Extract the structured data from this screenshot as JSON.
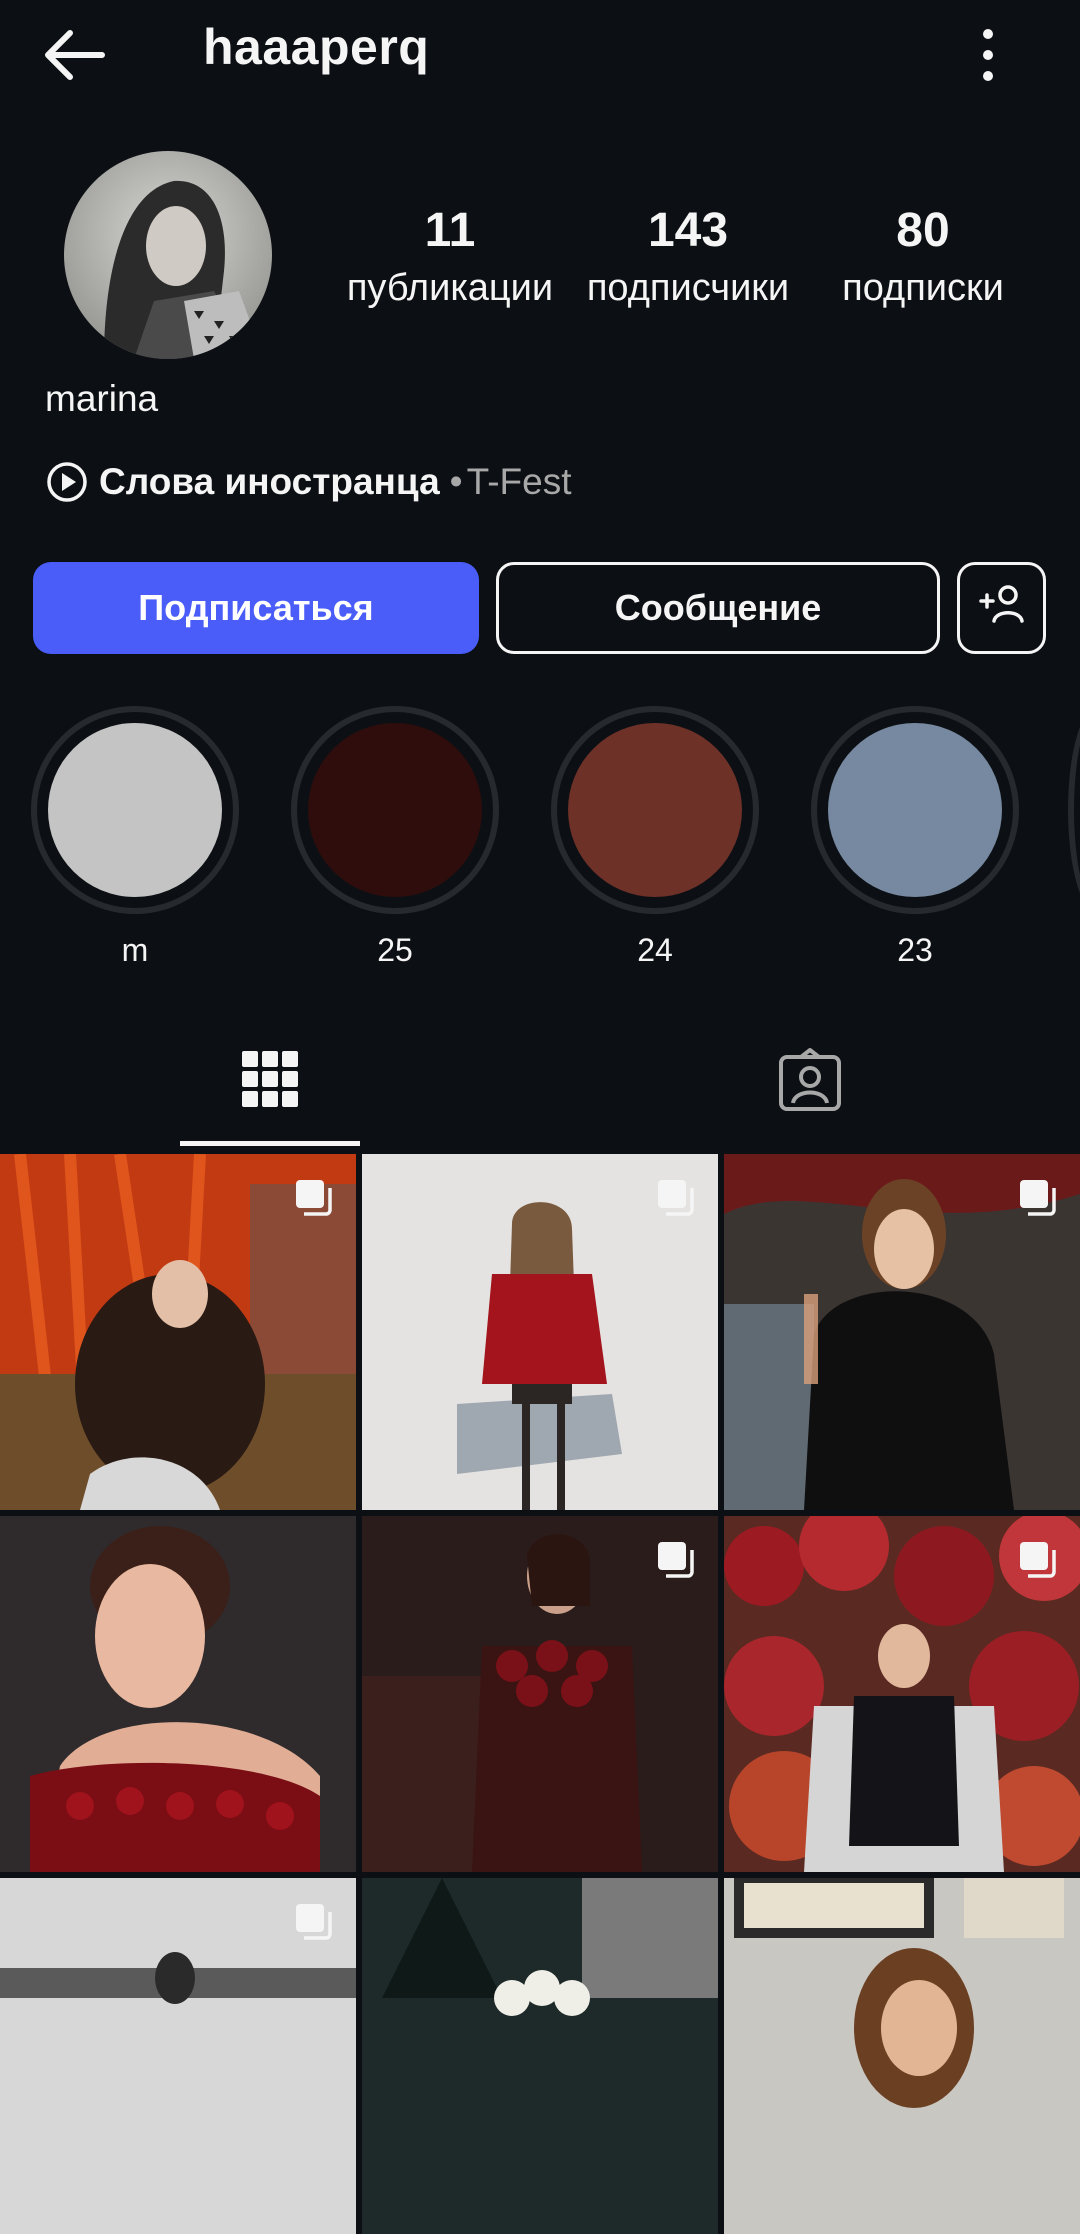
{
  "header": {
    "username": "haaaperq",
    "back_icon": "arrow-left-icon",
    "more_icon": "more-vertical-icon"
  },
  "profile": {
    "full_name": "marina",
    "stats": [
      {
        "value": "11",
        "label": "публикации"
      },
      {
        "value": "143",
        "label": "подписчики"
      },
      {
        "value": "80",
        "label": "подписки"
      }
    ],
    "music": {
      "song": "Слова иностранца",
      "separator": " • ",
      "artist": "T-Fest",
      "icon": "play-circle-icon"
    }
  },
  "actions": {
    "follow_label": "Подписаться",
    "message_label": "Сообщение",
    "add_user_icon": "add-user-icon"
  },
  "highlights": [
    {
      "label": "m",
      "color": "#c4c4c4"
    },
    {
      "label": "25",
      "color": "#2e0d0c"
    },
    {
      "label": "24",
      "color": "#6e3128"
    },
    {
      "label": "23",
      "color": "#7789a0"
    }
  ],
  "tabs": [
    {
      "name": "posts",
      "icon": "grid-icon",
      "active": true
    },
    {
      "name": "tagged",
      "icon": "tagged-icon",
      "active": false
    }
  ],
  "colors": {
    "background": "#0c1014",
    "accent": "#4a5df9",
    "text": "#f5f5f5",
    "muted": "#a8a8a8"
  }
}
